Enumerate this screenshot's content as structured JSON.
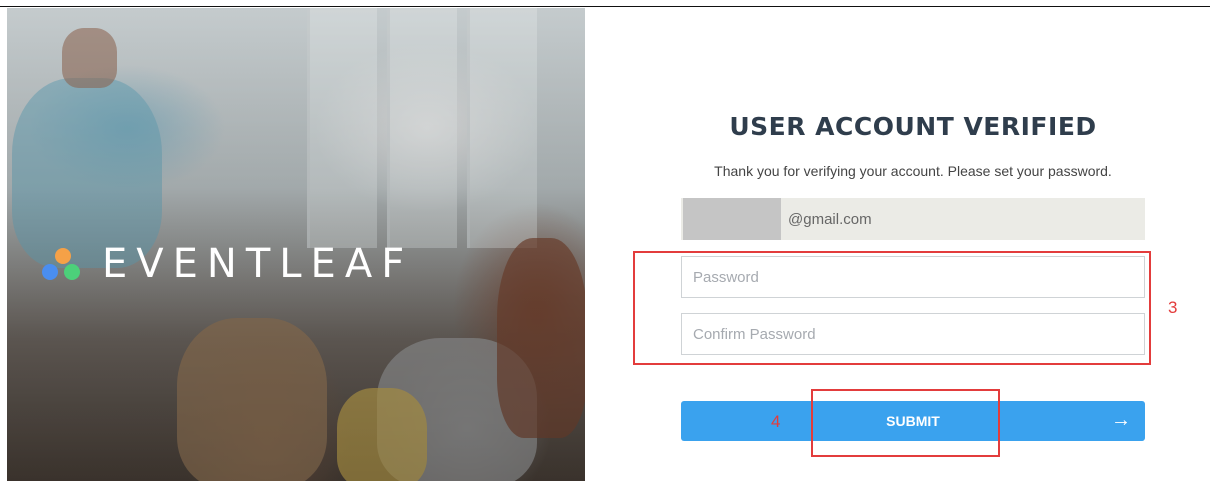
{
  "brand": {
    "name": "EVENTLEAF",
    "dot_colors": [
      "#f5a147",
      "#4a8ef0",
      "#4cd07a"
    ]
  },
  "form": {
    "title": "USER ACCOUNT VERIFIED",
    "subtitle": "Thank you for verifying your account. Please set your password.",
    "email_value": "@gmail.com",
    "password_placeholder": "Password",
    "confirm_placeholder": "Confirm Password",
    "submit_label": "SUBMIT",
    "submit_arrow": "→"
  },
  "annotations": {
    "fields_label": "3",
    "submit_label": "4",
    "color": "#e33c3c"
  },
  "colors": {
    "accent": "#3aa2ee",
    "title": "#2f3d4c"
  }
}
